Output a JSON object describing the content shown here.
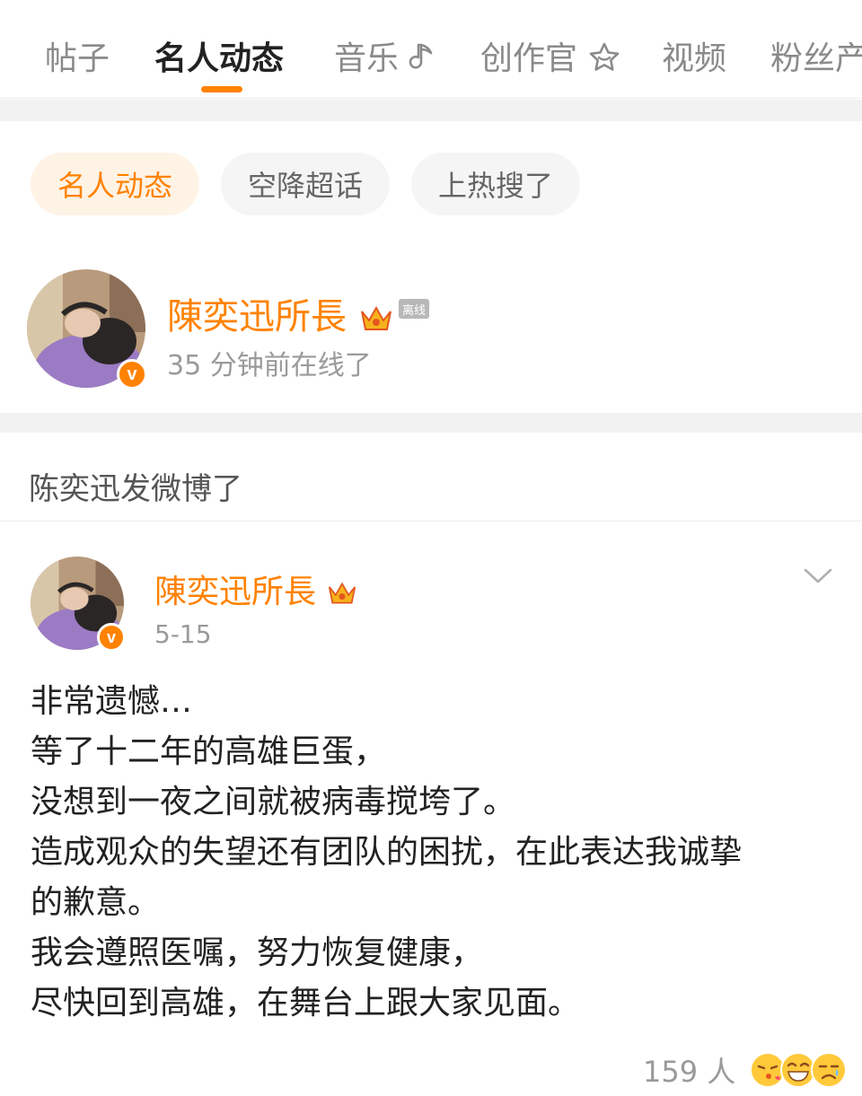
{
  "tabs": [
    {
      "label": "帖子",
      "icon": ""
    },
    {
      "label": "名人动态",
      "icon": ""
    },
    {
      "label": "音乐",
      "icon": "music-note-icon"
    },
    {
      "label": "创作官",
      "icon": "star-badge-icon"
    },
    {
      "label": "视频",
      "icon": ""
    },
    {
      "label": "粉丝产",
      "icon": ""
    }
  ],
  "active_tab": "名人动态",
  "accent_color": "#ff8200",
  "chips": [
    "名人动态",
    "空降超话",
    "上热搜了"
  ],
  "profile": {
    "name": "陳奕迅所長",
    "status_tag": "离线",
    "last_online": "35 分钟前在线了",
    "verified_mark": "v"
  },
  "feed": {
    "section_title": "陈奕迅发微博了"
  },
  "post": {
    "author": "陳奕迅所長",
    "date": "5-15",
    "lines": [
      "非常遗憾…",
      "等了十二年的高雄巨蛋，",
      "没想到一夜之间就被病毒搅垮了。",
      "造成观众的失望还有团队的困扰，在此表达我诚挚",
      "的歉意。",
      "我会遵照医嘱，努力恢复健康，",
      "尽快回到高雄，在舞台上跟大家见面。"
    ],
    "reaction_count": "159 人",
    "reaction_icons": [
      "kiss-face-icon",
      "laughing-face-icon",
      "crying-face-icon"
    ]
  }
}
